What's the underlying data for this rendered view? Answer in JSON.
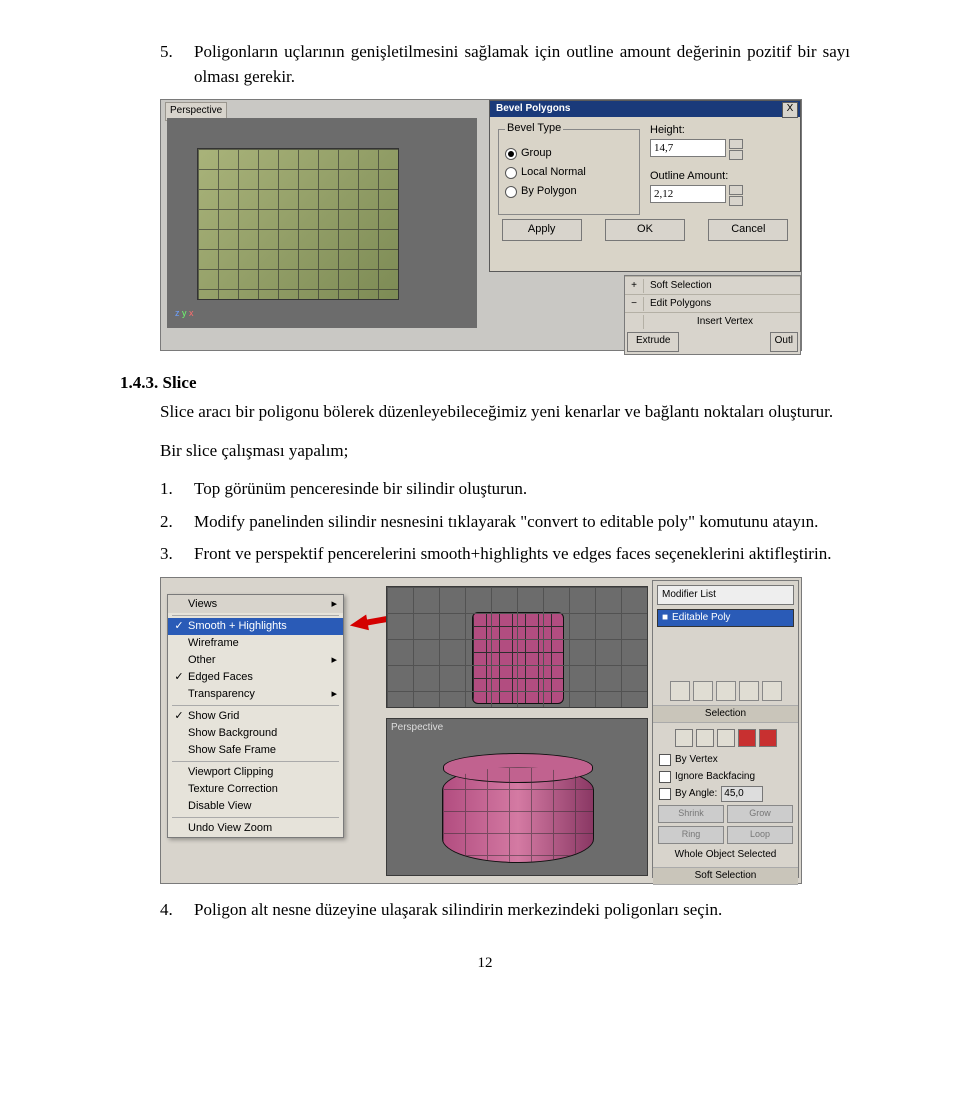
{
  "intro": {
    "num": "5.",
    "text": "Poligonların uçlarının genişletilmesini sağlamak için outline amount değerinin pozitif bir sayı olması gerekir."
  },
  "fig1": {
    "perspective_label": "Perspective",
    "dialog_title": "Bevel Polygons",
    "close_glyph": "X",
    "bevel_type_legend": "Bevel Type",
    "radios": {
      "group": "Group",
      "local_normal": "Local Normal",
      "by_polygon": "By Polygon"
    },
    "height_label": "Height:",
    "height_value": "14,7",
    "outline_label": "Outline Amount:",
    "outline_value": "2,12",
    "apply": "Apply",
    "ok": "OK",
    "cancel": "Cancel",
    "rollouts": {
      "soft_selection": "Soft Selection",
      "edit_polygons": "Edit Polygons",
      "insert_vertex": "Insert Vertex",
      "extrude": "Extrude",
      "outl": "Outl"
    },
    "gizmo": {
      "z": "z",
      "y": "y",
      "x": "x"
    }
  },
  "section": {
    "number": "1.4.3.",
    "title_rest": " Slice",
    "body": "Slice aracı bir poligonu bölerek düzenleyebileceğimiz yeni kenarlar ve bağlantı noktaları oluşturur.",
    "sub": "Bir slice çalışması yapalım;",
    "items": [
      {
        "n": "1.",
        "t": "Top görünüm penceresinde bir silindir oluşturun."
      },
      {
        "n": "2.",
        "t": "Modify panelinden silindir nesnesini tıklayarak \"convert to editable poly\" komutunu atayın."
      },
      {
        "n": "3.",
        "t": "Front ve perspektif pencerelerini smooth+highlights ve edges faces seçeneklerini aktifleştirin."
      }
    ]
  },
  "fig2": {
    "menu": {
      "views": "Views",
      "smooth": "Smooth + Highlights",
      "wireframe": "Wireframe",
      "other": "Other",
      "edged": "Edged Faces",
      "transparency": "Transparency",
      "show_grid": "Show Grid",
      "show_bg": "Show Background",
      "show_safe": "Show Safe Frame",
      "vp_clip": "Viewport Clipping",
      "tex_corr": "Texture Correction",
      "disable": "Disable View",
      "undo": "Undo View Zoom"
    },
    "persp_label": "Perspective",
    "panel": {
      "modlist": "Modifier List",
      "editable_poly": "Editable Poly",
      "selection_title": "Selection",
      "by_vertex": "By Vertex",
      "ignore_bf": "Ignore Backfacing",
      "by_angle": "By Angle:",
      "angle_val": "45,0",
      "shrink": "Shrink",
      "grow": "Grow",
      "ring": "Ring",
      "loop": "Loop",
      "whole": "Whole Object Selected",
      "soft_sel": "Soft Selection"
    }
  },
  "after": {
    "num": "4.",
    "text": "Poligon alt nesne düzeyine ulaşarak silindirin merkezindeki poligonları seçin."
  },
  "page_number": "12"
}
